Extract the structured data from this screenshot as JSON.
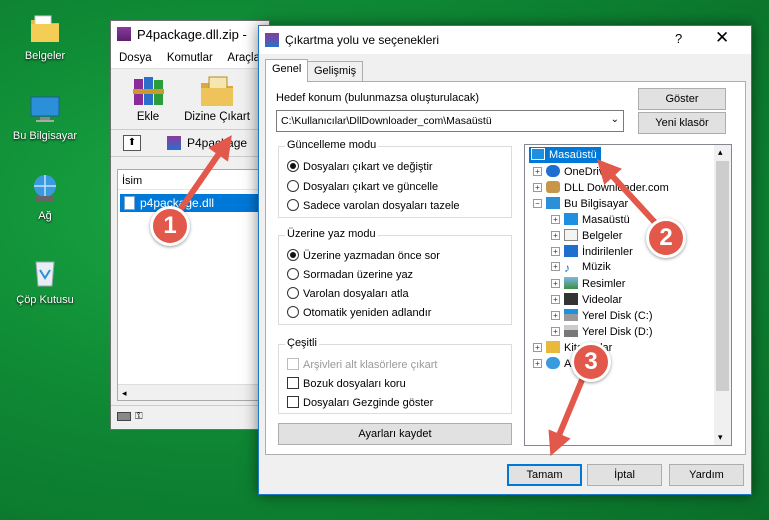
{
  "desktop": {
    "icons": [
      {
        "label": "Belgeler",
        "icon": "folder-documents-icon"
      },
      {
        "label": "Bu Bilgisayar",
        "icon": "computer-icon"
      },
      {
        "label": "Ağ",
        "icon": "network-icon"
      },
      {
        "label": "Çöp Kutusu",
        "icon": "recycle-bin-icon"
      }
    ]
  },
  "rar": {
    "title": "P4package.dll.zip -",
    "menu": [
      "Dosya",
      "Komutlar",
      "Araçla"
    ],
    "tools": {
      "add": "Ekle",
      "extract_to": "Dizine Çıkart"
    },
    "address": "P4package",
    "column_name": "İsim",
    "file": "p4package.dll"
  },
  "dialog": {
    "title": "Çıkartma yolu ve seçenekleri",
    "help": "?",
    "close": "✕",
    "tabs": [
      "Genel",
      "Gelişmiş"
    ],
    "dest_label": "Hedef konum (bulunmazsa oluşturulacak)",
    "dest_value": "C:\\Kullanıcılar\\DllDownloader_com\\Masaüstü",
    "show_btn": "Göster",
    "new_folder_btn": "Yeni klasör",
    "update_mode": {
      "label": "Güncelleme modu",
      "options": [
        "Dosyaları çıkart ve değiştir",
        "Dosyaları çıkart ve güncelle",
        "Sadece varolan dosyaları tazele"
      ]
    },
    "overwrite_mode": {
      "label": "Üzerine yaz modu",
      "options": [
        "Üzerine yazmadan önce sor",
        "Sormadan üzerine yaz",
        "Varolan dosyaları atla",
        "Otomatik yeniden adlandır"
      ]
    },
    "misc": {
      "label": "Çeşitli",
      "options": [
        "Arşivleri alt klasörlere çıkart",
        "Bozuk dosyaları koru",
        "Dosyaları Gezginde göster"
      ]
    },
    "save_settings": "Ayarları kaydet",
    "tree": [
      "Masaüstü",
      "OneDrive",
      "DLL Downloader.com",
      "Bu Bilgisayar",
      "Masaüstü",
      "Belgeler",
      "İndirilenler",
      "Müzik",
      "Resimler",
      "Videolar",
      "Yerel Disk (C:)",
      "Yerel Disk (D:)",
      "Kitaplıklar",
      "Ağ"
    ],
    "buttons": {
      "ok": "Tamam",
      "cancel": "İptal",
      "help": "Yardım"
    }
  },
  "annotations": [
    "1",
    "2",
    "3"
  ],
  "colors": {
    "accent": "#0078d7",
    "badge": "#e2584a",
    "arrow": "#e2584a",
    "desktop": "#0f8a35"
  }
}
